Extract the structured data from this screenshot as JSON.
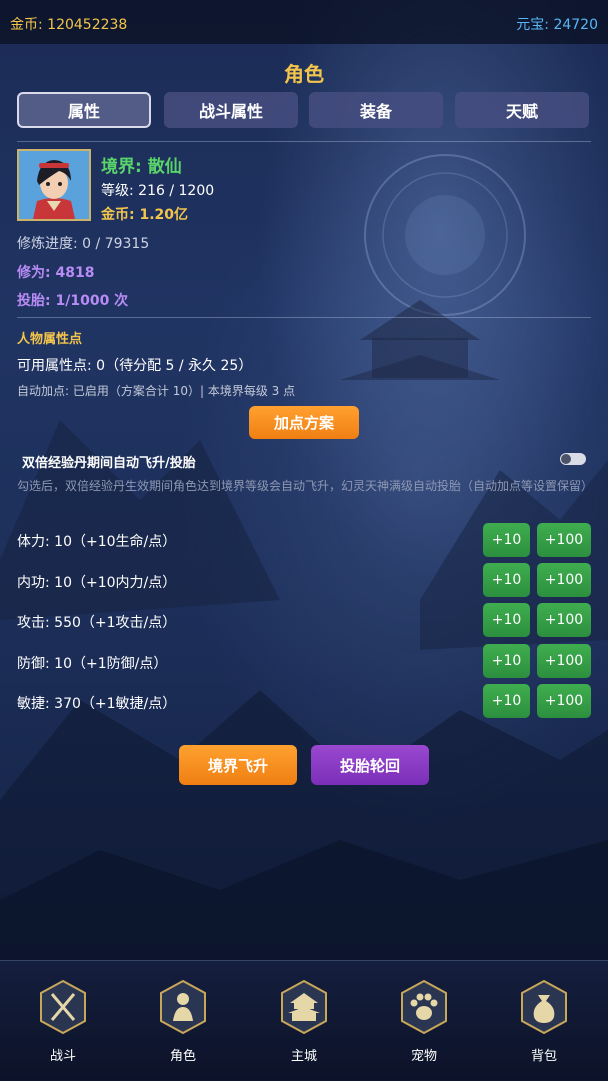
{
  "topbar": {
    "gold_label": "金币:",
    "gold_value": "120452238",
    "yuanbao_label": "元宝:",
    "yuanbao_value": "24720"
  },
  "page_title": "角色",
  "tabs": [
    {
      "label": "属性",
      "active": true
    },
    {
      "label": "战斗属性",
      "active": false
    },
    {
      "label": "装备",
      "active": false
    },
    {
      "label": "天赋",
      "active": false
    }
  ],
  "profile": {
    "realm_label": "境界:",
    "realm_value": "散仙",
    "level_label": "等级:",
    "level_value": "216 / 1200",
    "gold_label": "金币:",
    "gold_value": "1.20亿",
    "cultivation_progress_label": "修炼进度:",
    "cultivation_progress_value": "0 / 79315",
    "xiuwei_label": "修为:",
    "xiuwei_value": "4818",
    "reincarnate_label": "投胎:",
    "reincarnate_value": "1/1000 次"
  },
  "attributes": {
    "section_title": "人物属性点",
    "available_label": "可用属性点:",
    "available_value": "0（待分配 5 / 永久 25）",
    "auto_label": "自动加点:",
    "auto_value": "已启用（方案合计 10）| 本境界每级 3 点",
    "plan_button": "加点方案",
    "auto_ascend_label": "双倍经验丹期间自动飞升/投胎",
    "auto_ascend_enabled": true,
    "auto_ascend_desc": "勾选后，双倍经验丹生效期间角色达到境界等级会自动飞升，幻灵天神满级自动投胎（自动加点等设置保留）",
    "rows": [
      {
        "label": "体力:",
        "value": "10（+10生命/点）",
        "btn10": "+10",
        "btn100": "+100"
      },
      {
        "label": "内功:",
        "value": "10（+10内力/点）",
        "btn10": "+10",
        "btn100": "+100"
      },
      {
        "label": "攻击:",
        "value": "550（+1攻击/点）",
        "btn10": "+10",
        "btn100": "+100"
      },
      {
        "label": "防御:",
        "value": "10（+1防御/点）",
        "btn10": "+10",
        "btn100": "+100"
      },
      {
        "label": "敏捷:",
        "value": "370（+1敏捷/点）",
        "btn10": "+10",
        "btn100": "+100"
      }
    ]
  },
  "actions": {
    "ascend_button": "境界飞升",
    "reincarnate_button": "投胎轮回"
  },
  "bottom_nav": [
    {
      "label": "战斗",
      "icon": "crossed-swords-icon"
    },
    {
      "label": "角色",
      "icon": "character-icon"
    },
    {
      "label": "主城",
      "icon": "pagoda-icon"
    },
    {
      "label": "宠物",
      "icon": "paw-icon"
    },
    {
      "label": "背包",
      "icon": "bag-icon"
    }
  ],
  "colors": {
    "gold": "#f3c54b",
    "green": "#58d46a",
    "purple": "#b88cf5",
    "orange_button": "#f58a1c",
    "violet_button": "#8a3cc4",
    "green_button": "#35a046",
    "yuanbao": "#58b6f5"
  }
}
